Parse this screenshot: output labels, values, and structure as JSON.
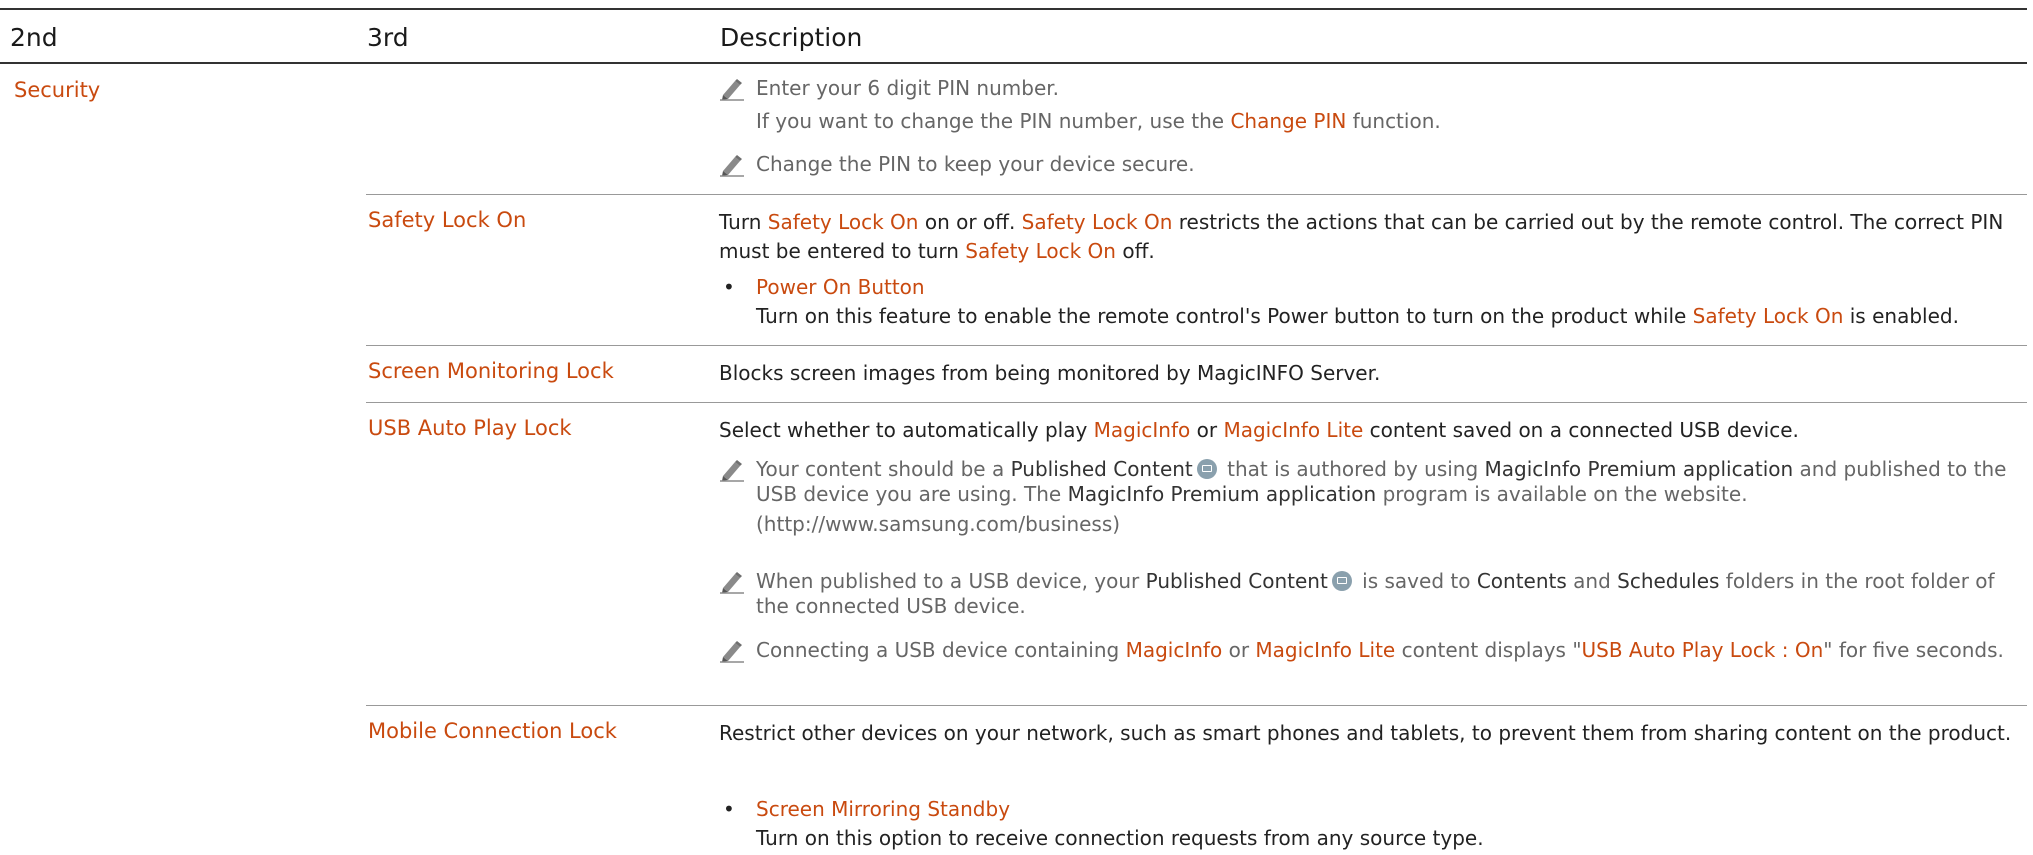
{
  "table": {
    "headers": {
      "col2": "2nd",
      "col3": "3rd",
      "desc": "Description"
    },
    "section_label": "Security"
  },
  "pin_row": {
    "note1_line1": "Enter your 6 digit PIN number.",
    "note1_line2a": "If you want to change the PIN number, use the ",
    "note1_line2_link": "Change PIN",
    "note1_line2b": " function.",
    "note2": "Change the PIN to keep your device secure."
  },
  "safety_lock": {
    "label": "Safety Lock On",
    "d1": "Turn ",
    "d1_hl": "Safety Lock On",
    "d2": " on or off. ",
    "d2_hl": "Safety Lock On",
    "d3": " restricts the actions that can be carried out by the remote control. The correct PIN must be entered to turn ",
    "d3_hl": "Safety Lock On",
    "d4": " off.",
    "bullet_title": "Power On Button",
    "bullet_desc_a": "Turn on this feature to enable the remote control's Power button to turn on the product while ",
    "bullet_desc_hl": "Safety Lock On",
    "bullet_desc_b": " is enabled."
  },
  "screen_monitoring": {
    "label": "Screen Monitoring Lock",
    "desc": "Blocks screen images from being monitored by MagicINFO Server."
  },
  "usb_auto_play": {
    "label": "USB Auto Play Lock",
    "d1": "Select whether to automatically play ",
    "d1_hl": "MagicInfo",
    "d2": " or ",
    "d2_hl": "MagicInfo Lite",
    "d3": " content saved on a connected USB device.",
    "n1_a": "Your content should be a ",
    "n1_b1": "Published Content",
    "n1_c": " that is authored by using ",
    "n1_b2": "MagicInfo Premium application",
    "n1_d": " and published to the USB device you are using. The ",
    "n1_b3": "MagicInfo Premium application",
    "n1_e": " program is available on the website.",
    "n1_url": "(http://www.samsung.com/business)",
    "n2_a": "When published to a USB device, your ",
    "n2_b1": "Published Content",
    "n2_c": " is saved to ",
    "n2_b2": "Contents",
    "n2_d": " and ",
    "n2_b3": "Schedules",
    "n2_e": " folders in the root folder of the connected USB device.",
    "n3_a": "Connecting a USB device containing ",
    "n3_hl1": "MagicInfo",
    "n3_b": " or ",
    "n3_hl2": "MagicInfo Lite",
    "n3_c": " content displays \"",
    "n3_hl3": "USB Auto Play Lock : On",
    "n3_d": "\" for five seconds."
  },
  "mobile_connection": {
    "label": "Mobile Connection Lock",
    "desc": "Restrict other devices on your network, such as smart phones and tablets, to prevent them from sharing content on the product.",
    "bullet_title": "Screen Mirroring Standby",
    "bullet_desc": "Turn on this option to receive connection requests from any source type."
  },
  "colors": {
    "accent": "#c94a0f",
    "note_text": "#666666",
    "body_text": "#222222"
  },
  "icons": [
    "pencil-note-icon",
    "published-content-icon"
  ]
}
